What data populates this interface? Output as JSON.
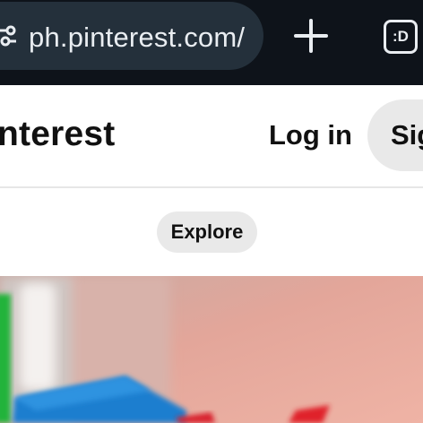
{
  "browser": {
    "url": "ph.pinterest.com/",
    "new_tab_symbol": "+",
    "tab_count_label": ":D",
    "icons": {
      "site_info": "site-settings-icon",
      "new_tab": "plus-icon"
    },
    "colors": {
      "toolbar": "#0e131a",
      "url_pill": "#24303b",
      "text": "#e9edf1"
    }
  },
  "header": {
    "brand": "interest",
    "login_label": "Log in",
    "signup_label": "Sign up"
  },
  "nav": {
    "explore_label": "Explore"
  },
  "hero": {
    "description_icon": "blurred-toy-photo"
  }
}
